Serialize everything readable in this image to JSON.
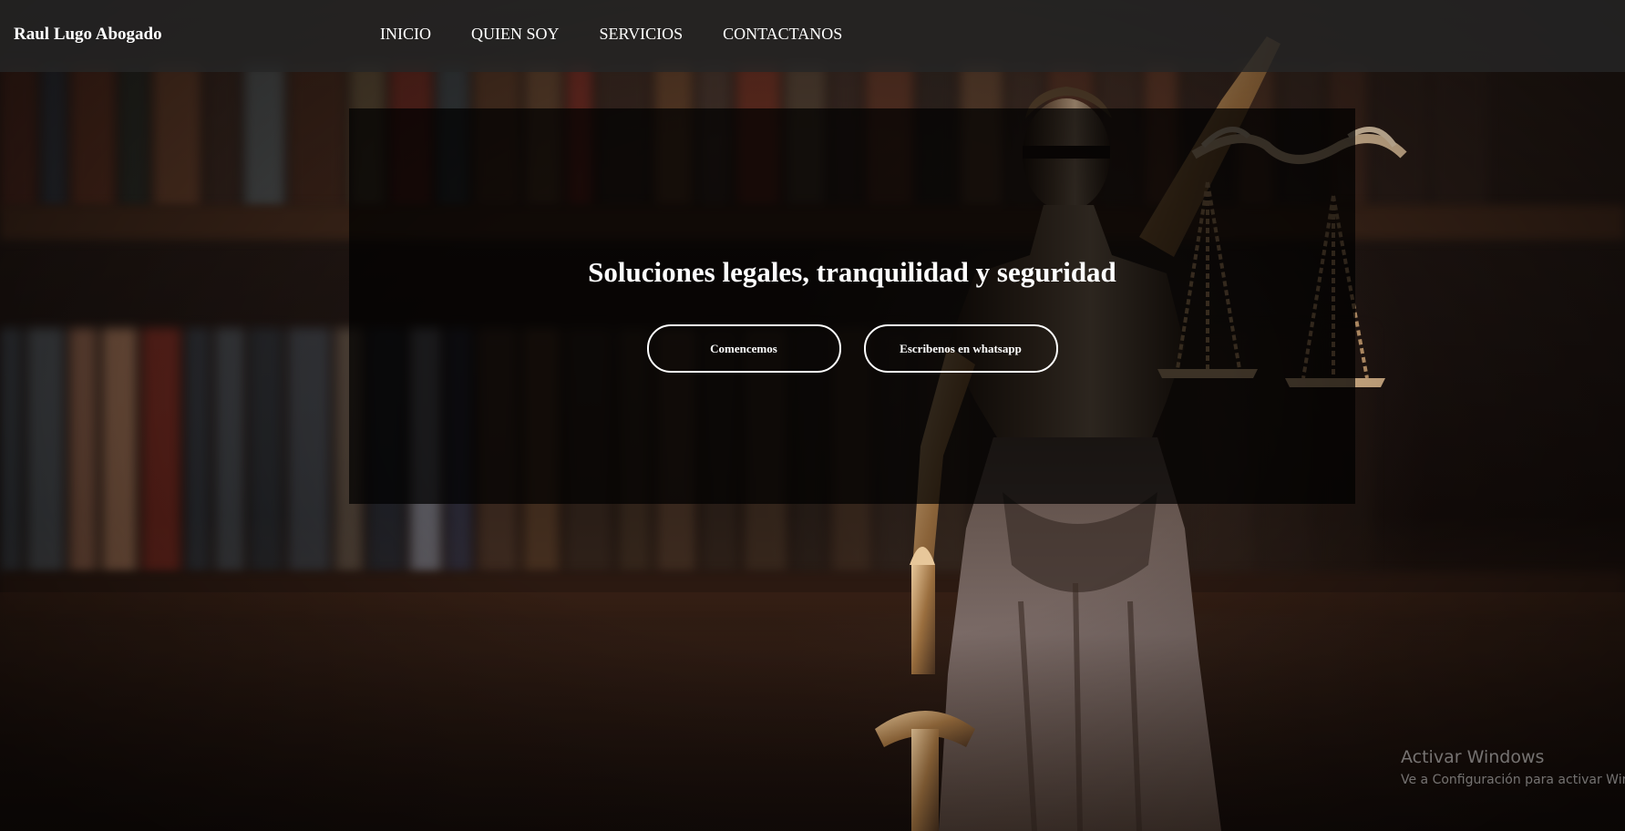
{
  "header": {
    "brand": "Raul Lugo Abogado",
    "nav": [
      {
        "label": "INICIO"
      },
      {
        "label": "QUIEN SOY"
      },
      {
        "label": "SERVICIOS"
      },
      {
        "label": "CONTACTANOS"
      }
    ]
  },
  "hero": {
    "title": "Soluciones legales, tranquilidad y seguridad",
    "buttons": [
      {
        "label": "Comencemos"
      },
      {
        "label": "Escribenos en whatsapp"
      }
    ]
  },
  "background": {
    "image": "lady-justice-statue-bookshelf"
  },
  "watermark": {
    "title": "Activar Windows",
    "subtitle": "Ve a Configuración para activar Wind"
  }
}
